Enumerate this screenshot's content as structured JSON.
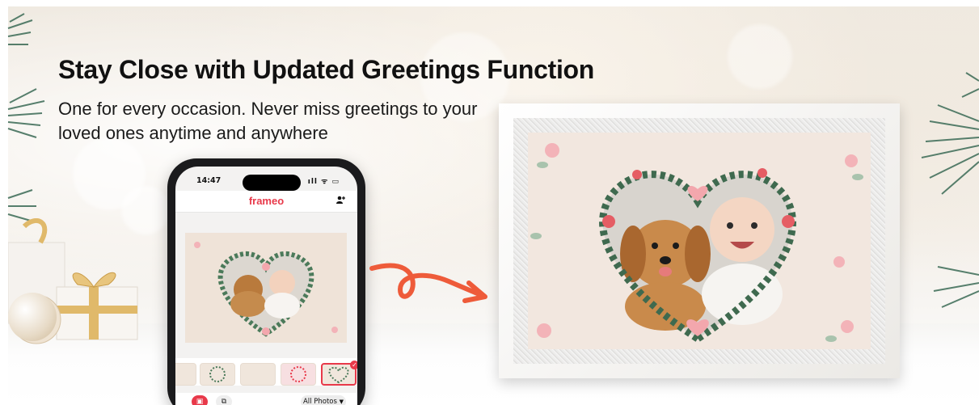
{
  "headline": {
    "title": "Stay Close with Updated Greetings Function",
    "subtitle": "One for every occasion. Never miss greetings to your loved ones anytime and anywhere"
  },
  "phone": {
    "status_time": "14:47",
    "status_icons": "ıll ᯤ ▭",
    "app_name": "frameo",
    "add_user_icon": "person-add-icon",
    "all_photos_label": "All Photos",
    "dropdown_icon": "▼"
  },
  "colors": {
    "brand_red": "#e8394a",
    "arrow_orange": "#ee5b3a",
    "wreath_green": "#3f6a4f",
    "flower_pink": "#f3b3b8",
    "frame_white": "#f9f8f6",
    "display_bg": "#f2e7df"
  }
}
